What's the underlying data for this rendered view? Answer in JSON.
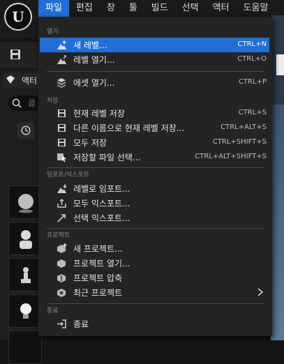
{
  "menubar": {
    "items": [
      {
        "label": "파일",
        "active": true
      },
      {
        "label": "편집"
      },
      {
        "label": "창"
      },
      {
        "label": "툴"
      },
      {
        "label": "빌드"
      },
      {
        "label": "선택"
      },
      {
        "label": "액터"
      },
      {
        "label": "도움말"
      }
    ]
  },
  "logo": {
    "letter": "U"
  },
  "side_panel": {
    "tab_label": "액터",
    "search_placeholder": "클",
    "asset_icons": [
      "sphere-icon",
      "mannequin-icon",
      "pawn-icon",
      "light-bulb-icon"
    ]
  },
  "dropdown": {
    "sections": {
      "open": "열기",
      "save": "저장",
      "import_export": "임포트/익스포트",
      "project": "프로젝트",
      "exit": "종료"
    },
    "items": {
      "new_level": {
        "label": "새 레벨...",
        "shortcut": "CTRL+N",
        "icon": "new-level-icon"
      },
      "open_level": {
        "label": "레벨 열기...",
        "shortcut": "CTRL+O",
        "icon": "open-level-icon"
      },
      "open_asset": {
        "label": "에셋 열기...",
        "shortcut": "CTRL+P",
        "icon": "open-asset-icon"
      },
      "save_current": {
        "label": "현재 레벨 저장",
        "shortcut": "CTRL+S",
        "icon": "save-icon"
      },
      "save_as": {
        "label": "다른 이름으로 현재 레벨 저장...",
        "shortcut": "CTRL+ALT+S",
        "icon": "save-as-icon"
      },
      "save_all": {
        "label": "모두 저장",
        "shortcut": "CTRL+SHIFT+S",
        "icon": "save-all-icon"
      },
      "choose_files": {
        "label": "저장할 파일 선택...",
        "shortcut": "CTRL+ALT+SHIFT+S",
        "icon": "choose-files-icon"
      },
      "import_level": {
        "label": "레벨로 임포트...",
        "icon": "import-icon"
      },
      "export_all": {
        "label": "모두 익스포트...",
        "icon": "export-all-icon"
      },
      "export_selected": {
        "label": "선택 익스포트...",
        "icon": "export-selected-icon"
      },
      "new_project": {
        "label": "새 프로젝트...",
        "icon": "new-project-icon"
      },
      "open_project": {
        "label": "프로젝트 열기...",
        "icon": "open-project-icon"
      },
      "zip_project": {
        "label": "프로젝트 압축",
        "icon": "zip-project-icon"
      },
      "recent_projects": {
        "label": "최근 프로젝트",
        "icon": "recent-projects-icon"
      },
      "exit": {
        "label": "종료",
        "icon": "exit-icon"
      }
    }
  },
  "colors": {
    "accent": "#1f6fd6",
    "menu_bg": "#242424"
  }
}
